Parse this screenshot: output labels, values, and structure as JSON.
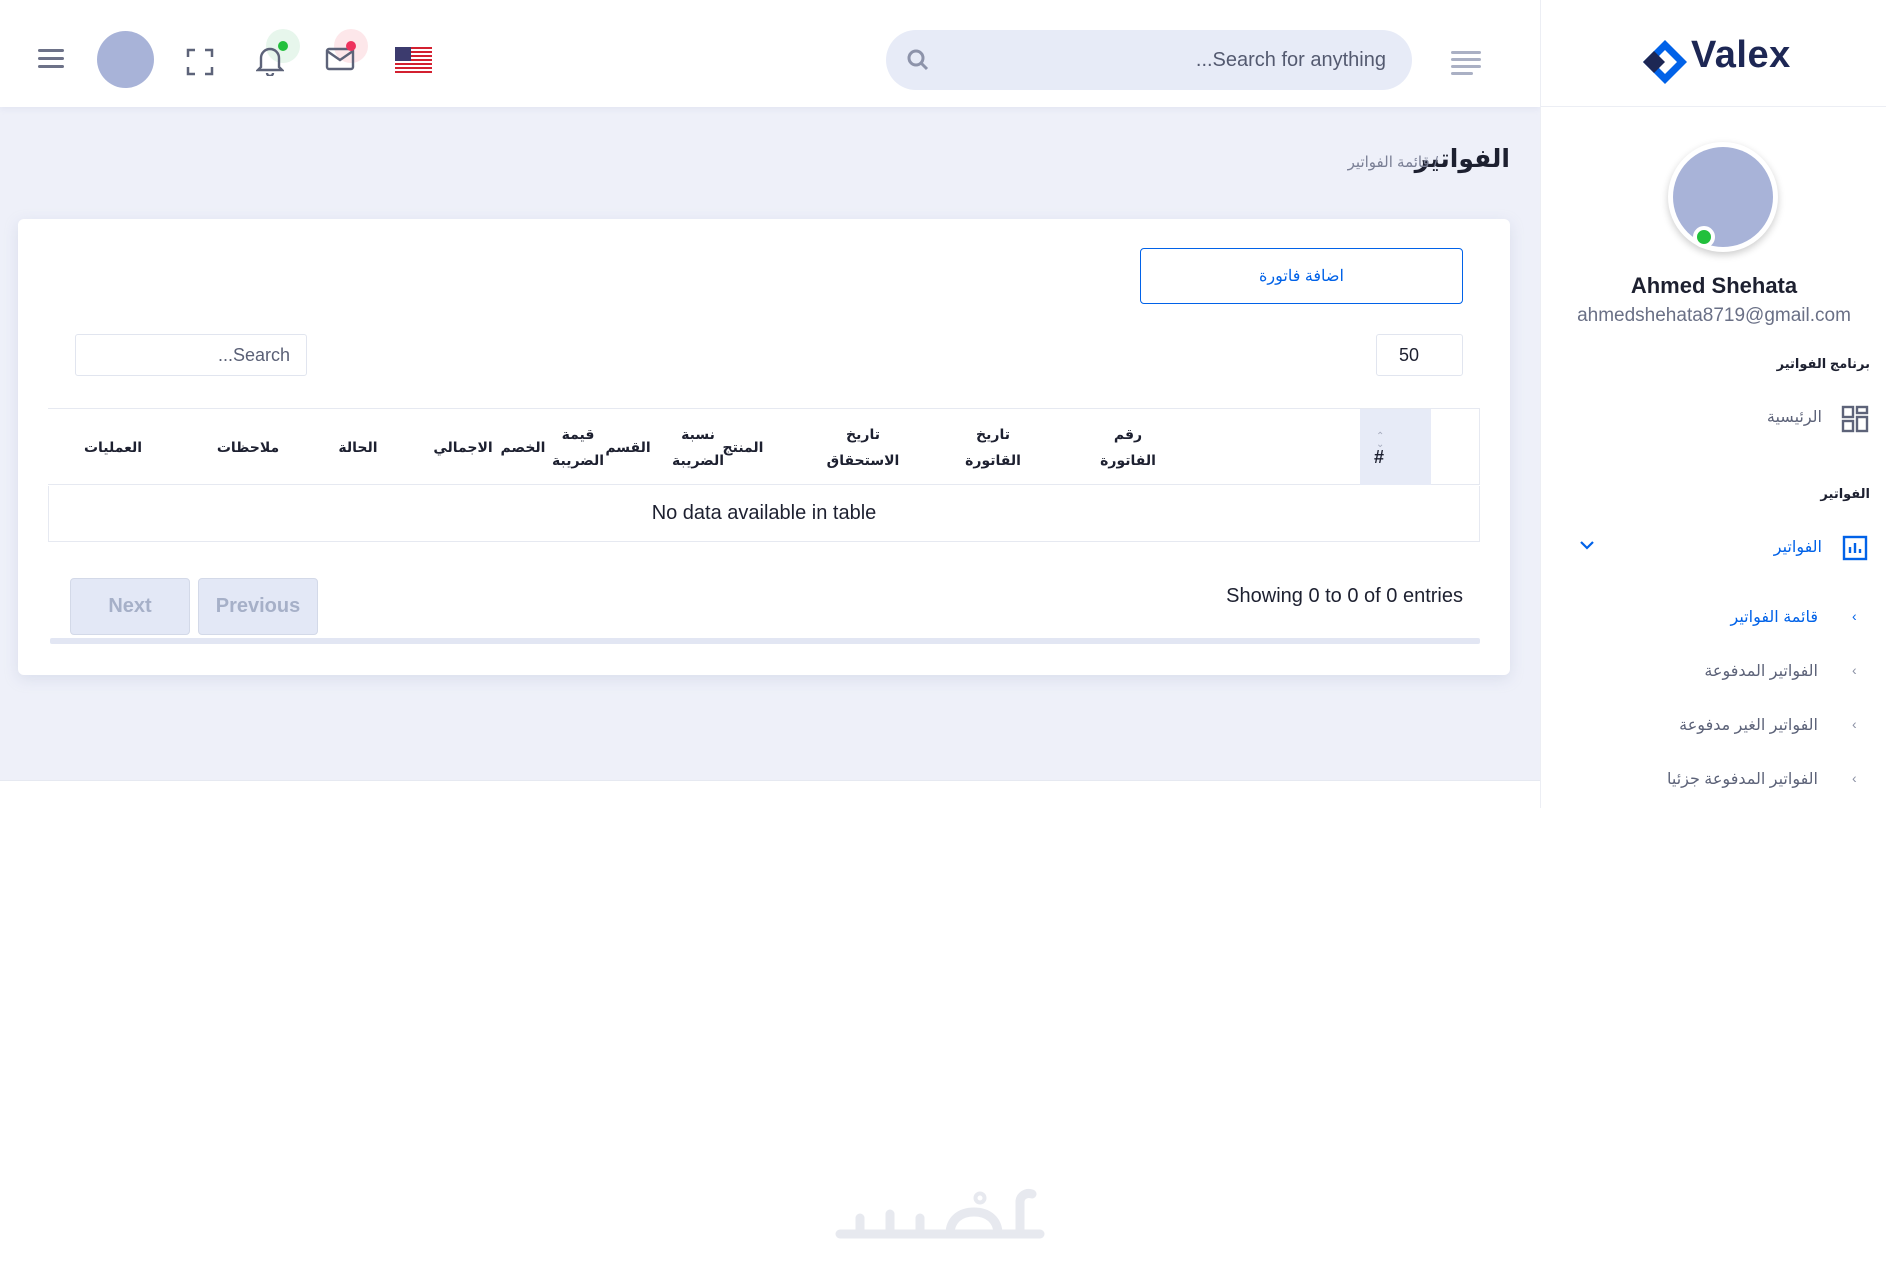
{
  "topbar": {
    "search_placeholder": "...Search for anything",
    "icons": [
      "menu-icon",
      "avatar",
      "fullscreen-icon",
      "bell-icon",
      "mail-icon",
      "us-flag-icon",
      "align-right-icon",
      "search-icon"
    ],
    "bell_dot_color": "#22c03c",
    "mail_dot_color": "#ee335e"
  },
  "page": {
    "title": "الفواتير",
    "breadcrumb": "/ قائمة الفواتير"
  },
  "card": {
    "add_button_label": "اضافة فاتورة",
    "page_length_value": "50",
    "search_placeholder": "...Search",
    "table": {
      "hash_header": "#",
      "headers": [
        {
          "line1": "رقم",
          "line2": "الفاتورة"
        },
        {
          "line1": "تاريخ",
          "line2": "القاتورة"
        },
        {
          "line1": "تاريخ",
          "line2": "الاستحقاق"
        },
        {
          "line1": "",
          "line2": "المنتج"
        },
        {
          "line1": "",
          "line2": "القسم"
        },
        {
          "line1": "",
          "line2": "الخصم"
        },
        {
          "line1": "نسبة",
          "line2": "الضريبة"
        },
        {
          "line1": "قيمة",
          "line2": "الضريبة"
        },
        {
          "line1": "",
          "line2": "الاجمالي"
        },
        {
          "line1": "",
          "line2": "الحالة"
        },
        {
          "line1": "",
          "line2": "ملاحظات"
        },
        {
          "line1": "",
          "line2": "العمليات"
        }
      ],
      "empty_message": "No data available in table"
    },
    "info_text": "Showing 0 to 0 of 0 entries",
    "next_label": "Next",
    "previous_label": "Previous"
  },
  "sidebar": {
    "brand": "Valex",
    "user_name": "Ahmed Shehata",
    "user_email": "ahmedshehata8719@gmail.com",
    "online_color": "#22c03c",
    "category_main": "برنامج الفواتير",
    "home_label": "الرئيسية",
    "category_invoices": "الفواتير",
    "invoices_label": "الفواتير",
    "sub_items": [
      {
        "label": "قائمة الفواتير",
        "active": true
      },
      {
        "label": "الفواتير المدفوعة",
        "active": false
      },
      {
        "label": "الفواتير الغير مدفوعة",
        "active": false
      },
      {
        "label": "الفواتير المدفوعة جزئيا",
        "active": false
      }
    ]
  },
  "colors": {
    "accent": "#0162e8",
    "background": "#eef0f9",
    "brand_navy": "#1d2754"
  },
  "watermark": "خمسات"
}
